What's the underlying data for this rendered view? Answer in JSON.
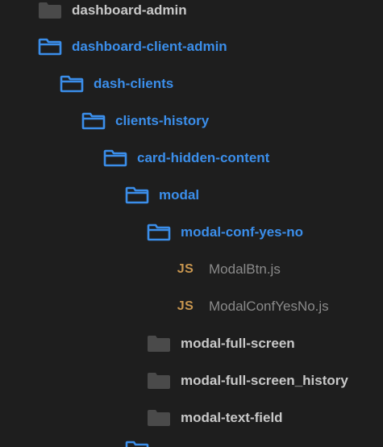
{
  "explorer": {
    "items": [
      {
        "label": "dashboard-admin",
        "type": "folder",
        "state": "closed",
        "icon": "folder-closed-icon",
        "depth": 0
      },
      {
        "label": "dashboard-client-admin",
        "type": "folder",
        "state": "open",
        "icon": "folder-open-icon",
        "depth": 0
      },
      {
        "label": "dash-clients",
        "type": "folder",
        "state": "open",
        "icon": "folder-open-icon",
        "depth": 1
      },
      {
        "label": "clients-history",
        "type": "folder",
        "state": "open",
        "icon": "folder-open-icon",
        "depth": 2
      },
      {
        "label": "card-hidden-content",
        "type": "folder",
        "state": "open",
        "icon": "folder-open-icon",
        "depth": 3
      },
      {
        "label": "modal",
        "type": "folder",
        "state": "open",
        "icon": "folder-open-icon",
        "depth": 4
      },
      {
        "label": "modal-conf-yes-no",
        "type": "folder",
        "state": "open",
        "icon": "folder-open-icon",
        "depth": 5
      },
      {
        "label": "ModalBtn.js",
        "type": "file",
        "icon": "js-file-icon",
        "icon_text": "JS",
        "depth": 6
      },
      {
        "label": "ModalConfYesNo.js",
        "type": "file",
        "icon": "js-file-icon",
        "icon_text": "JS",
        "depth": 6
      },
      {
        "label": "modal-full-screen",
        "type": "folder",
        "state": "closed",
        "icon": "folder-closed-icon",
        "depth": 5
      },
      {
        "label": "modal-full-screen_history",
        "type": "folder",
        "state": "closed",
        "icon": "folder-closed-icon",
        "depth": 5
      },
      {
        "label": "modal-text-field",
        "type": "folder",
        "state": "closed",
        "icon": "folder-closed-icon",
        "depth": 5
      }
    ]
  },
  "colors": {
    "background": "#1e1e1e",
    "open_folder": "#3b8eea",
    "closed_folder": "#4a4a4a",
    "open_label": "#3b8eea",
    "closed_label": "#c8c8c8",
    "file_label": "#8a8a8a",
    "js_icon": "#c8964f"
  }
}
